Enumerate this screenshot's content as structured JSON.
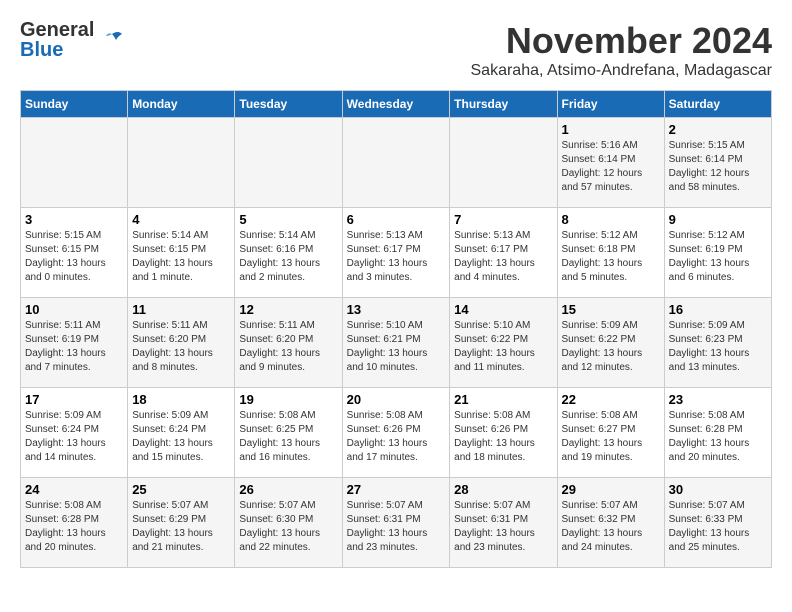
{
  "logo": {
    "general": "General",
    "blue": "Blue"
  },
  "title": {
    "month": "November 2024",
    "subtitle": "Sakaraha, Atsimo-Andrefana, Madagascar"
  },
  "weekdays": [
    "Sunday",
    "Monday",
    "Tuesday",
    "Wednesday",
    "Thursday",
    "Friday",
    "Saturday"
  ],
  "weeks": [
    [
      {
        "day": "",
        "sunrise": "",
        "sunset": "",
        "daylight": ""
      },
      {
        "day": "",
        "sunrise": "",
        "sunset": "",
        "daylight": ""
      },
      {
        "day": "",
        "sunrise": "",
        "sunset": "",
        "daylight": ""
      },
      {
        "day": "",
        "sunrise": "",
        "sunset": "",
        "daylight": ""
      },
      {
        "day": "",
        "sunrise": "",
        "sunset": "",
        "daylight": ""
      },
      {
        "day": "1",
        "sunrise": "Sunrise: 5:16 AM",
        "sunset": "Sunset: 6:14 PM",
        "daylight": "Daylight: 12 hours and 57 minutes."
      },
      {
        "day": "2",
        "sunrise": "Sunrise: 5:15 AM",
        "sunset": "Sunset: 6:14 PM",
        "daylight": "Daylight: 12 hours and 58 minutes."
      }
    ],
    [
      {
        "day": "3",
        "sunrise": "Sunrise: 5:15 AM",
        "sunset": "Sunset: 6:15 PM",
        "daylight": "Daylight: 13 hours and 0 minutes."
      },
      {
        "day": "4",
        "sunrise": "Sunrise: 5:14 AM",
        "sunset": "Sunset: 6:15 PM",
        "daylight": "Daylight: 13 hours and 1 minute."
      },
      {
        "day": "5",
        "sunrise": "Sunrise: 5:14 AM",
        "sunset": "Sunset: 6:16 PM",
        "daylight": "Daylight: 13 hours and 2 minutes."
      },
      {
        "day": "6",
        "sunrise": "Sunrise: 5:13 AM",
        "sunset": "Sunset: 6:17 PM",
        "daylight": "Daylight: 13 hours and 3 minutes."
      },
      {
        "day": "7",
        "sunrise": "Sunrise: 5:13 AM",
        "sunset": "Sunset: 6:17 PM",
        "daylight": "Daylight: 13 hours and 4 minutes."
      },
      {
        "day": "8",
        "sunrise": "Sunrise: 5:12 AM",
        "sunset": "Sunset: 6:18 PM",
        "daylight": "Daylight: 13 hours and 5 minutes."
      },
      {
        "day": "9",
        "sunrise": "Sunrise: 5:12 AM",
        "sunset": "Sunset: 6:19 PM",
        "daylight": "Daylight: 13 hours and 6 minutes."
      }
    ],
    [
      {
        "day": "10",
        "sunrise": "Sunrise: 5:11 AM",
        "sunset": "Sunset: 6:19 PM",
        "daylight": "Daylight: 13 hours and 7 minutes."
      },
      {
        "day": "11",
        "sunrise": "Sunrise: 5:11 AM",
        "sunset": "Sunset: 6:20 PM",
        "daylight": "Daylight: 13 hours and 8 minutes."
      },
      {
        "day": "12",
        "sunrise": "Sunrise: 5:11 AM",
        "sunset": "Sunset: 6:20 PM",
        "daylight": "Daylight: 13 hours and 9 minutes."
      },
      {
        "day": "13",
        "sunrise": "Sunrise: 5:10 AM",
        "sunset": "Sunset: 6:21 PM",
        "daylight": "Daylight: 13 hours and 10 minutes."
      },
      {
        "day": "14",
        "sunrise": "Sunrise: 5:10 AM",
        "sunset": "Sunset: 6:22 PM",
        "daylight": "Daylight: 13 hours and 11 minutes."
      },
      {
        "day": "15",
        "sunrise": "Sunrise: 5:09 AM",
        "sunset": "Sunset: 6:22 PM",
        "daylight": "Daylight: 13 hours and 12 minutes."
      },
      {
        "day": "16",
        "sunrise": "Sunrise: 5:09 AM",
        "sunset": "Sunset: 6:23 PM",
        "daylight": "Daylight: 13 hours and 13 minutes."
      }
    ],
    [
      {
        "day": "17",
        "sunrise": "Sunrise: 5:09 AM",
        "sunset": "Sunset: 6:24 PM",
        "daylight": "Daylight: 13 hours and 14 minutes."
      },
      {
        "day": "18",
        "sunrise": "Sunrise: 5:09 AM",
        "sunset": "Sunset: 6:24 PM",
        "daylight": "Daylight: 13 hours and 15 minutes."
      },
      {
        "day": "19",
        "sunrise": "Sunrise: 5:08 AM",
        "sunset": "Sunset: 6:25 PM",
        "daylight": "Daylight: 13 hours and 16 minutes."
      },
      {
        "day": "20",
        "sunrise": "Sunrise: 5:08 AM",
        "sunset": "Sunset: 6:26 PM",
        "daylight": "Daylight: 13 hours and 17 minutes."
      },
      {
        "day": "21",
        "sunrise": "Sunrise: 5:08 AM",
        "sunset": "Sunset: 6:26 PM",
        "daylight": "Daylight: 13 hours and 18 minutes."
      },
      {
        "day": "22",
        "sunrise": "Sunrise: 5:08 AM",
        "sunset": "Sunset: 6:27 PM",
        "daylight": "Daylight: 13 hours and 19 minutes."
      },
      {
        "day": "23",
        "sunrise": "Sunrise: 5:08 AM",
        "sunset": "Sunset: 6:28 PM",
        "daylight": "Daylight: 13 hours and 20 minutes."
      }
    ],
    [
      {
        "day": "24",
        "sunrise": "Sunrise: 5:08 AM",
        "sunset": "Sunset: 6:28 PM",
        "daylight": "Daylight: 13 hours and 20 minutes."
      },
      {
        "day": "25",
        "sunrise": "Sunrise: 5:07 AM",
        "sunset": "Sunset: 6:29 PM",
        "daylight": "Daylight: 13 hours and 21 minutes."
      },
      {
        "day": "26",
        "sunrise": "Sunrise: 5:07 AM",
        "sunset": "Sunset: 6:30 PM",
        "daylight": "Daylight: 13 hours and 22 minutes."
      },
      {
        "day": "27",
        "sunrise": "Sunrise: 5:07 AM",
        "sunset": "Sunset: 6:31 PM",
        "daylight": "Daylight: 13 hours and 23 minutes."
      },
      {
        "day": "28",
        "sunrise": "Sunrise: 5:07 AM",
        "sunset": "Sunset: 6:31 PM",
        "daylight": "Daylight: 13 hours and 23 minutes."
      },
      {
        "day": "29",
        "sunrise": "Sunrise: 5:07 AM",
        "sunset": "Sunset: 6:32 PM",
        "daylight": "Daylight: 13 hours and 24 minutes."
      },
      {
        "day": "30",
        "sunrise": "Sunrise: 5:07 AM",
        "sunset": "Sunset: 6:33 PM",
        "daylight": "Daylight: 13 hours and 25 minutes."
      }
    ]
  ]
}
